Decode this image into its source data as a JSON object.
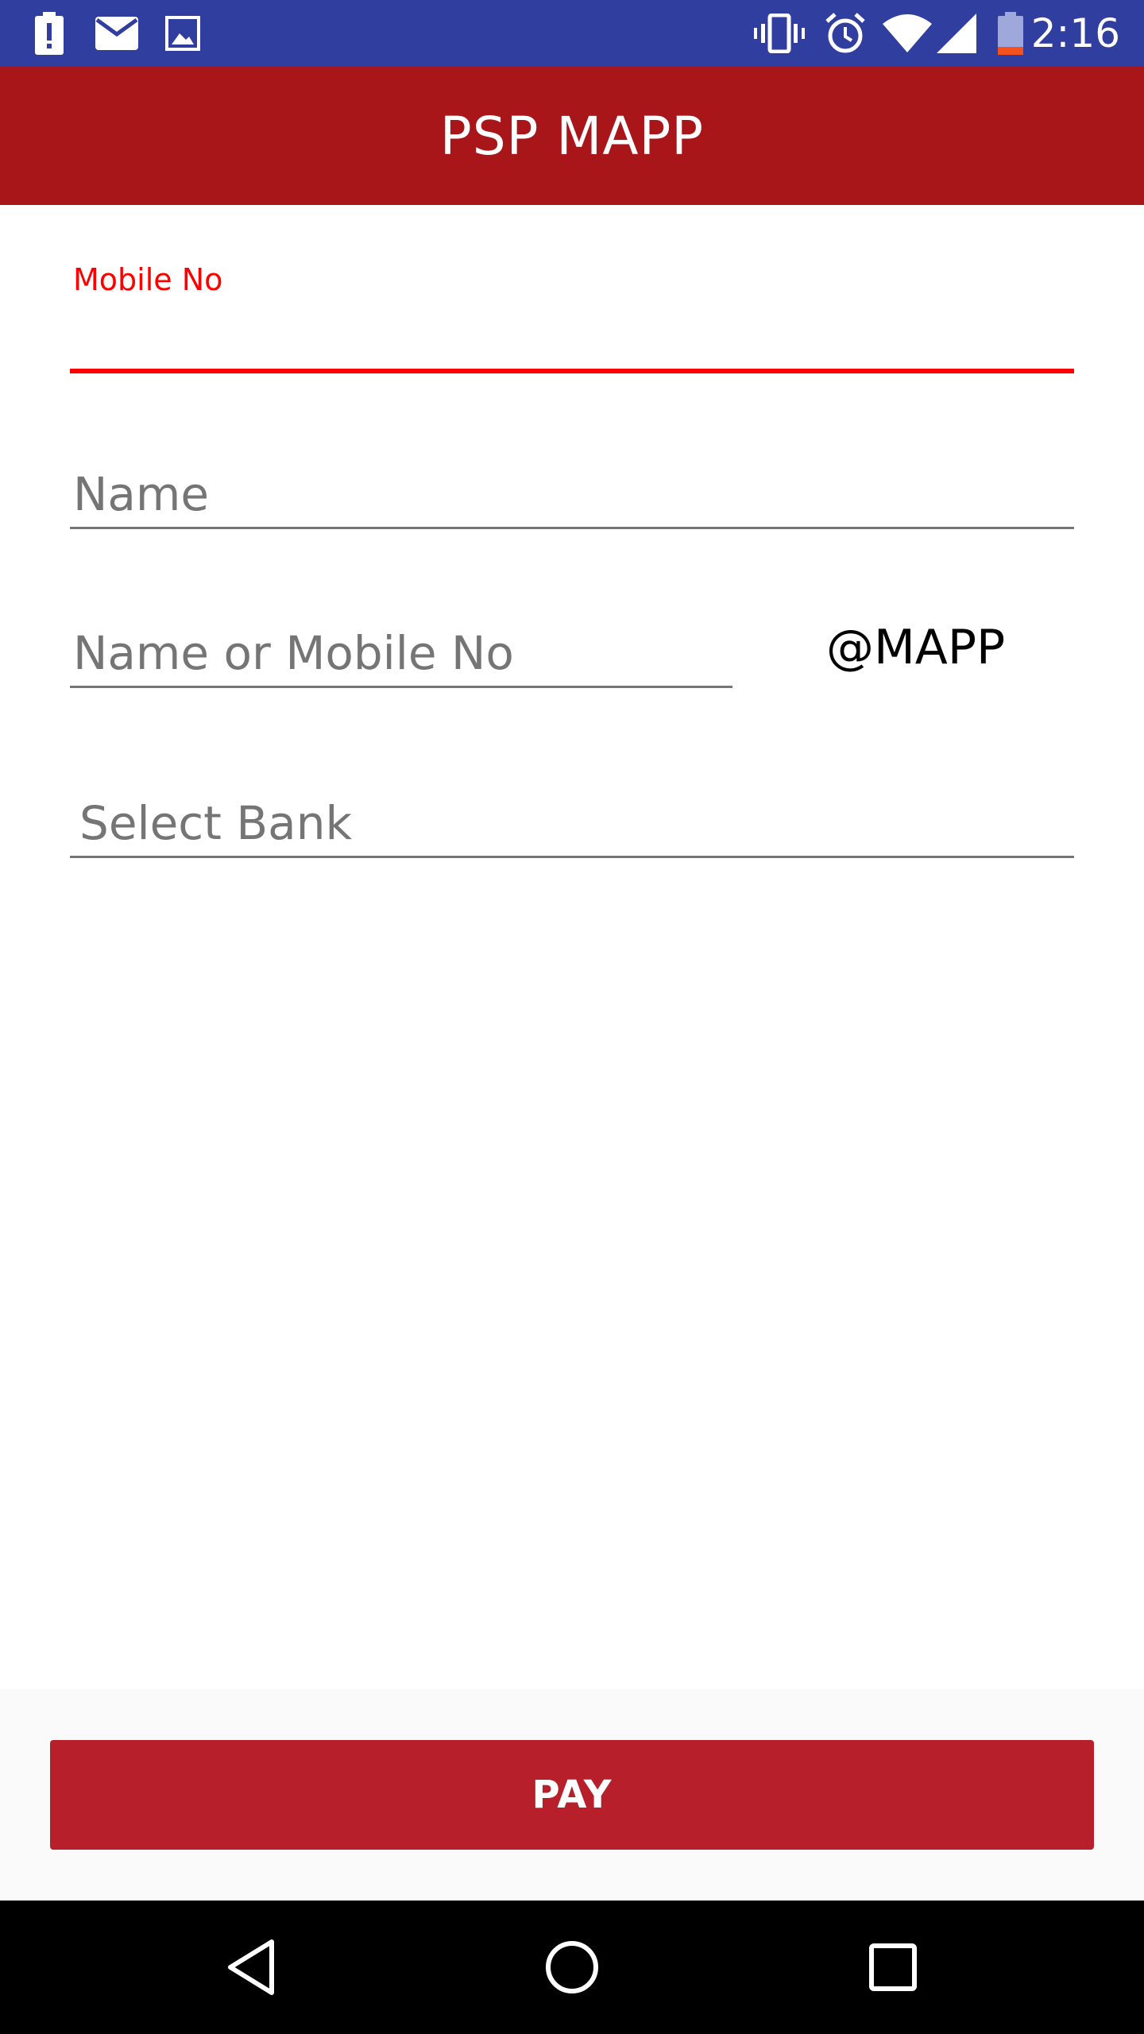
{
  "status_bar": {
    "time": "2:16",
    "left_icons": [
      "battery-alert-icon",
      "mail-icon",
      "image-icon"
    ],
    "right_icons": [
      "vibrate-icon",
      "alarm-icon",
      "wifi-icon",
      "signal-icon",
      "battery-icon"
    ]
  },
  "app_bar": {
    "title": "PSP MAPP",
    "color": "#A8161A"
  },
  "form": {
    "mobile": {
      "label": "Mobile No",
      "value": ""
    },
    "name": {
      "placeholder": "Name",
      "value": ""
    },
    "vpa": {
      "placeholder": "Name or Mobile No",
      "value": "",
      "suffix": "@MAPP"
    },
    "bank": {
      "placeholder": "Select Bank"
    }
  },
  "actions": {
    "pay_label": "PAY",
    "pay_color": "#B71F2A"
  },
  "nav_bar": {
    "icons": [
      "back-icon",
      "home-icon",
      "recents-icon"
    ]
  }
}
